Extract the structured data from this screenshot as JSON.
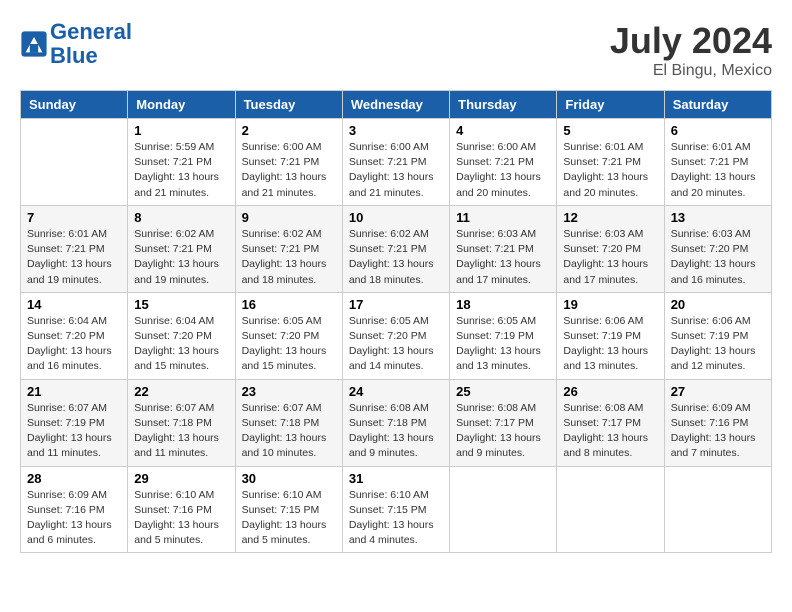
{
  "header": {
    "logo_line1": "General",
    "logo_line2": "Blue",
    "month_year": "July 2024",
    "location": "El Bingu, Mexico"
  },
  "days_of_week": [
    "Sunday",
    "Monday",
    "Tuesday",
    "Wednesday",
    "Thursday",
    "Friday",
    "Saturday"
  ],
  "weeks": [
    [
      {
        "day": "",
        "info": ""
      },
      {
        "day": "1",
        "info": "Sunrise: 5:59 AM\nSunset: 7:21 PM\nDaylight: 13 hours\nand 21 minutes."
      },
      {
        "day": "2",
        "info": "Sunrise: 6:00 AM\nSunset: 7:21 PM\nDaylight: 13 hours\nand 21 minutes."
      },
      {
        "day": "3",
        "info": "Sunrise: 6:00 AM\nSunset: 7:21 PM\nDaylight: 13 hours\nand 21 minutes."
      },
      {
        "day": "4",
        "info": "Sunrise: 6:00 AM\nSunset: 7:21 PM\nDaylight: 13 hours\nand 20 minutes."
      },
      {
        "day": "5",
        "info": "Sunrise: 6:01 AM\nSunset: 7:21 PM\nDaylight: 13 hours\nand 20 minutes."
      },
      {
        "day": "6",
        "info": "Sunrise: 6:01 AM\nSunset: 7:21 PM\nDaylight: 13 hours\nand 20 minutes."
      }
    ],
    [
      {
        "day": "7",
        "info": "Sunrise: 6:01 AM\nSunset: 7:21 PM\nDaylight: 13 hours\nand 19 minutes."
      },
      {
        "day": "8",
        "info": "Sunrise: 6:02 AM\nSunset: 7:21 PM\nDaylight: 13 hours\nand 19 minutes."
      },
      {
        "day": "9",
        "info": "Sunrise: 6:02 AM\nSunset: 7:21 PM\nDaylight: 13 hours\nand 18 minutes."
      },
      {
        "day": "10",
        "info": "Sunrise: 6:02 AM\nSunset: 7:21 PM\nDaylight: 13 hours\nand 18 minutes."
      },
      {
        "day": "11",
        "info": "Sunrise: 6:03 AM\nSunset: 7:21 PM\nDaylight: 13 hours\nand 17 minutes."
      },
      {
        "day": "12",
        "info": "Sunrise: 6:03 AM\nSunset: 7:20 PM\nDaylight: 13 hours\nand 17 minutes."
      },
      {
        "day": "13",
        "info": "Sunrise: 6:03 AM\nSunset: 7:20 PM\nDaylight: 13 hours\nand 16 minutes."
      }
    ],
    [
      {
        "day": "14",
        "info": "Sunrise: 6:04 AM\nSunset: 7:20 PM\nDaylight: 13 hours\nand 16 minutes."
      },
      {
        "day": "15",
        "info": "Sunrise: 6:04 AM\nSunset: 7:20 PM\nDaylight: 13 hours\nand 15 minutes."
      },
      {
        "day": "16",
        "info": "Sunrise: 6:05 AM\nSunset: 7:20 PM\nDaylight: 13 hours\nand 15 minutes."
      },
      {
        "day": "17",
        "info": "Sunrise: 6:05 AM\nSunset: 7:20 PM\nDaylight: 13 hours\nand 14 minutes."
      },
      {
        "day": "18",
        "info": "Sunrise: 6:05 AM\nSunset: 7:19 PM\nDaylight: 13 hours\nand 13 minutes."
      },
      {
        "day": "19",
        "info": "Sunrise: 6:06 AM\nSunset: 7:19 PM\nDaylight: 13 hours\nand 13 minutes."
      },
      {
        "day": "20",
        "info": "Sunrise: 6:06 AM\nSunset: 7:19 PM\nDaylight: 13 hours\nand 12 minutes."
      }
    ],
    [
      {
        "day": "21",
        "info": "Sunrise: 6:07 AM\nSunset: 7:19 PM\nDaylight: 13 hours\nand 11 minutes."
      },
      {
        "day": "22",
        "info": "Sunrise: 6:07 AM\nSunset: 7:18 PM\nDaylight: 13 hours\nand 11 minutes."
      },
      {
        "day": "23",
        "info": "Sunrise: 6:07 AM\nSunset: 7:18 PM\nDaylight: 13 hours\nand 10 minutes."
      },
      {
        "day": "24",
        "info": "Sunrise: 6:08 AM\nSunset: 7:18 PM\nDaylight: 13 hours\nand 9 minutes."
      },
      {
        "day": "25",
        "info": "Sunrise: 6:08 AM\nSunset: 7:17 PM\nDaylight: 13 hours\nand 9 minutes."
      },
      {
        "day": "26",
        "info": "Sunrise: 6:08 AM\nSunset: 7:17 PM\nDaylight: 13 hours\nand 8 minutes."
      },
      {
        "day": "27",
        "info": "Sunrise: 6:09 AM\nSunset: 7:16 PM\nDaylight: 13 hours\nand 7 minutes."
      }
    ],
    [
      {
        "day": "28",
        "info": "Sunrise: 6:09 AM\nSunset: 7:16 PM\nDaylight: 13 hours\nand 6 minutes."
      },
      {
        "day": "29",
        "info": "Sunrise: 6:10 AM\nSunset: 7:16 PM\nDaylight: 13 hours\nand 5 minutes."
      },
      {
        "day": "30",
        "info": "Sunrise: 6:10 AM\nSunset: 7:15 PM\nDaylight: 13 hours\nand 5 minutes."
      },
      {
        "day": "31",
        "info": "Sunrise: 6:10 AM\nSunset: 7:15 PM\nDaylight: 13 hours\nand 4 minutes."
      },
      {
        "day": "",
        "info": ""
      },
      {
        "day": "",
        "info": ""
      },
      {
        "day": "",
        "info": ""
      }
    ]
  ]
}
